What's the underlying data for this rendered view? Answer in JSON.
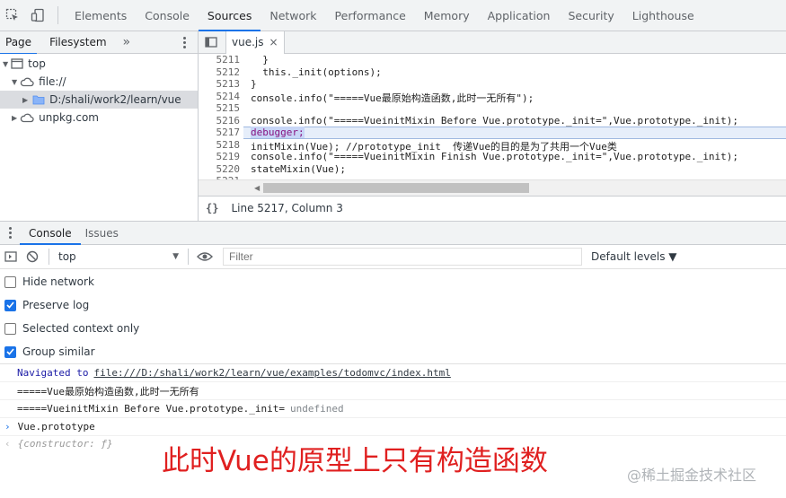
{
  "devtools": {
    "tabs": [
      "Elements",
      "Console",
      "Sources",
      "Network",
      "Performance",
      "Memory",
      "Application",
      "Security",
      "Lighthouse"
    ],
    "active_tab": "Sources"
  },
  "navigator": {
    "tabs": [
      "Page",
      "Filesystem"
    ],
    "more": "»",
    "tree": {
      "top": "top",
      "file": "file://",
      "folder": "D:/shali/work2/learn/vue",
      "unpkg": "unpkg.com"
    }
  },
  "editor": {
    "file_tab": "vue.js",
    "close": "×",
    "lines": [
      {
        "n": "5211",
        "code": "  }"
      },
      {
        "n": "5212",
        "code": "  this._init(options);"
      },
      {
        "n": "5213",
        "code": "}"
      },
      {
        "n": "5214",
        "code": "console.info(\"=====Vue最原始构造函数,此时一无所有\");"
      },
      {
        "n": "5215",
        "code": ""
      },
      {
        "n": "5216",
        "code": "console.info(\"=====VueinitMixin Before Vue.prototype._init=\",Vue.prototype._init);"
      },
      {
        "n": "5217",
        "code": "debugger;"
      },
      {
        "n": "5218",
        "code": "initMixin(Vue); //prototype_init  传递Vue的目的是为了共用一个Vue类"
      },
      {
        "n": "5219",
        "code": "console.info(\"=====VueinitMixin Finish Vue.prototype._init=\",Vue.prototype._init);"
      },
      {
        "n": "5220",
        "code": "stateMixin(Vue);"
      },
      {
        "n": "5221",
        "code": ""
      }
    ],
    "status_braces": "{}",
    "status": "Line 5217, Column 3"
  },
  "drawer": {
    "tabs": [
      "Console",
      "Issues"
    ],
    "context": "top",
    "filter_placeholder": "Filter",
    "levels": "Default levels ▼"
  },
  "settings": [
    {
      "label": "Hide network",
      "checked": false
    },
    {
      "label": "Preserve log",
      "checked": true
    },
    {
      "label": "Selected context only",
      "checked": false
    },
    {
      "label": "Group similar",
      "checked": true
    }
  ],
  "messages": {
    "nav_prefix": "Navigated to",
    "nav_url": "file:///D:/shali/work2/learn/vue/examples/todomvc/index.html",
    "log1": "=====Vue最原始构造函数,此时一无所有",
    "log2_text": "=====VueinitMixin Before Vue.prototype._init=",
    "log2_value": "undefined",
    "input": "Vue.prototype",
    "result": "{constructor: ƒ}"
  },
  "annotation": "此时Vue的原型上只有构造函数",
  "watermark": "@稀土掘金技术社区",
  "colors": {
    "accent": "#1a73e8",
    "annotation": "#e02020",
    "link": "#1a1aa6"
  }
}
